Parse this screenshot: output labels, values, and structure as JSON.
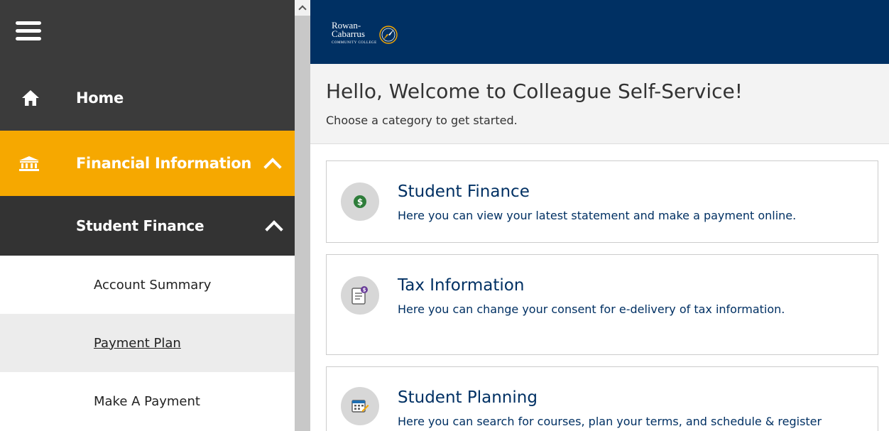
{
  "sidebar": {
    "items": [
      {
        "label": "Home",
        "icon": "home-icon"
      },
      {
        "label": "Financial Information",
        "icon": "bank-icon"
      },
      {
        "label": "Student Finance"
      }
    ],
    "subitems": [
      {
        "label": "Account Summary"
      },
      {
        "label": "Payment Plan"
      },
      {
        "label": "Make A Payment"
      }
    ]
  },
  "header": {
    "logo_line1": "Rowan-",
    "logo_line2": "Cabarrus",
    "logo_line3": "COMMUNITY COLLEGE"
  },
  "welcome": {
    "title": "Hello, Welcome to Colleague Self-Service!",
    "subtitle": "Choose a category to get started."
  },
  "cards": [
    {
      "title": "Student Finance",
      "desc": "Here you can view your latest statement and make a payment online.",
      "icon": "dollar-icon"
    },
    {
      "title": "Tax Information",
      "desc": "Here you can change your consent for e-delivery of tax information.",
      "icon": "tax-document-icon"
    },
    {
      "title": "Student Planning",
      "desc": "Here you can search for courses, plan your terms, and schedule & register",
      "icon": "calendar-icon"
    }
  ],
  "colors": {
    "sidebar_dark": "#3b3b3b",
    "accent": "#f6a800",
    "navy": "#003063"
  }
}
